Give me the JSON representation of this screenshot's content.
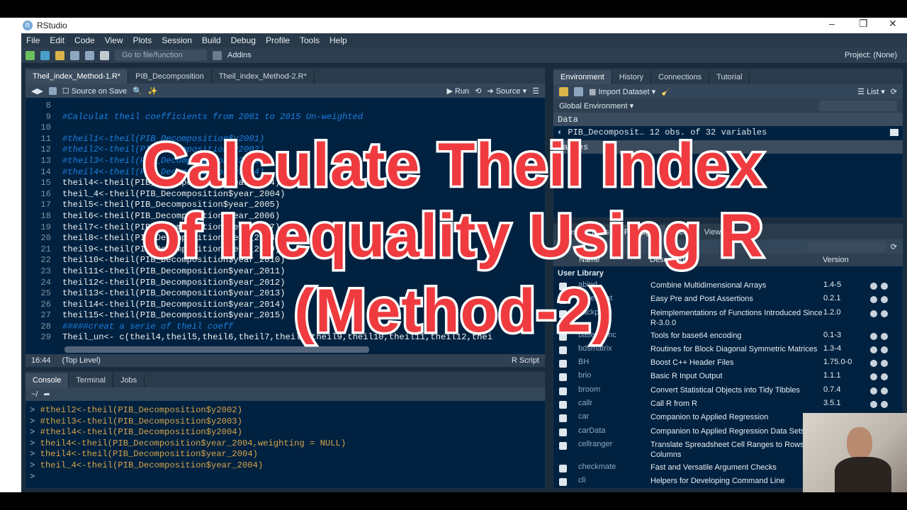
{
  "window": {
    "title": "RStudio",
    "controls": [
      "–",
      "❐",
      "✕"
    ]
  },
  "menu": [
    "File",
    "Edit",
    "Code",
    "View",
    "Plots",
    "Session",
    "Build",
    "Debug",
    "Profile",
    "Tools",
    "Help"
  ],
  "toolbar": {
    "goto_placeholder": "Go to file/function",
    "addins": "Addins",
    "project": "Project: (None)"
  },
  "editor": {
    "tabs": [
      {
        "label": "Theil_index_Method-1.R*",
        "active": true
      },
      {
        "label": "PIB_Decomposition",
        "active": false
      },
      {
        "label": "Theil_index_Method-2.R*",
        "active": false
      }
    ],
    "source_on_save": "Source on Save",
    "run": "Run",
    "source": "Source",
    "lines": [
      {
        "n": "8",
        "t": "",
        "c": false
      },
      {
        "n": "9",
        "t": "#Calculat theil coefficients from 2001 to 2015 Un-weighted",
        "c": true
      },
      {
        "n": "10",
        "t": "",
        "c": false
      },
      {
        "n": "11",
        "t": "#theil1<-theil(PIB_Decomposition$y2001)",
        "c": true
      },
      {
        "n": "12",
        "t": "#theil2<-theil(PIB_Decomposition$y2002)",
        "c": true
      },
      {
        "n": "13",
        "t": "#theil3<-theil(PIB_Decomposition$y2003)",
        "c": true
      },
      {
        "n": "14",
        "t": "#theil4<-theil(PIB_Decomposition$y2004)",
        "c": true
      },
      {
        "n": "15",
        "t": "theil4<-theil(PIB_Decomposition$year_2004)",
        "c": false
      },
      {
        "n": "16",
        "t": "theil_4<-theil(PIB_Decomposition$year_2004)",
        "c": false
      },
      {
        "n": "17",
        "t": "theil5<-theil(PIB_Decomposition$year_2005)",
        "c": false
      },
      {
        "n": "18",
        "t": "theil6<-theil(PIB_Decomposition$year_2006)",
        "c": false
      },
      {
        "n": "19",
        "t": "theil7<-theil(PIB_Decomposition$year_2007)",
        "c": false
      },
      {
        "n": "20",
        "t": "theil8<-theil(PIB_Decomposition$year_2008)",
        "c": false
      },
      {
        "n": "21",
        "t": "theil9<-theil(PIB_Decomposition$year_2009)",
        "c": false
      },
      {
        "n": "22",
        "t": "theil10<-theil(PIB_Decomposition$year_2010)",
        "c": false
      },
      {
        "n": "23",
        "t": "theil11<-theil(PIB_Decomposition$year_2011)",
        "c": false
      },
      {
        "n": "24",
        "t": "theil12<-theil(PIB_Decomposition$year_2012)",
        "c": false
      },
      {
        "n": "25",
        "t": "theil13<-theil(PIB_Decomposition$year_2013)",
        "c": false
      },
      {
        "n": "26",
        "t": "theil14<-theil(PIB_Decomposition$year_2014)",
        "c": false
      },
      {
        "n": "27",
        "t": "theil15<-theil(PIB_Decomposition$year_2015)",
        "c": false
      },
      {
        "n": "28",
        "t": "#####creat a serie of theil coeff",
        "c": true
      },
      {
        "n": "29",
        "t": "Theil_un<- c(theil4,theil5,theil6,theil7,theil8,theil9,theil10,theil11,theil12,thei",
        "c": false
      },
      {
        "n": "30",
        "t": "###########creat time series",
        "c": true
      }
    ],
    "status": {
      "pos": "16:44",
      "scope": "(Top Level)",
      "type": "R Script"
    }
  },
  "console": {
    "tabs": [
      "Console",
      "Terminal",
      "Jobs"
    ],
    "path": "~/",
    "lines": [
      "#theil2<-theil(PIB_Decomposition$y2002)",
      "#theil3<-theil(PIB_Decomposition$y2003)",
      "#theil4<-theil(PIB_Decomposition$y2004)",
      "theil4<-theil(PIB_Decomposition$year_2004,weighting = NULL)",
      "theil4<-theil(PIB_Decomposition$year_2004)",
      "theil_4<-theil(PIB_Decomposition$year_2004)"
    ],
    "prompt": ">"
  },
  "environment": {
    "tabs": [
      "Environment",
      "History",
      "Connections",
      "Tutorial"
    ],
    "import": "Import Dataset",
    "list": "List",
    "scope": "Global Environment",
    "data_header": "Data",
    "data_row": "PIB_Decomposit… 12 obs. of 32 variables",
    "values_header": "Values"
  },
  "packages": {
    "tabs": [
      "Files",
      "Plots",
      "Packages",
      "Help",
      "Viewer"
    ],
    "columns": [
      "Name",
      "Description",
      "Version"
    ],
    "section": "User Library",
    "rows": [
      {
        "name": "abind",
        "desc": "Combine Multidimensional Arrays",
        "ver": "1.4-5"
      },
      {
        "name": "assertthat",
        "desc": "Easy Pre and Post Assertions",
        "ver": "0.2.1"
      },
      {
        "name": "backports",
        "desc": "Reimplementations of Functions Introduced Since R-3.0.0",
        "ver": "1.2.0",
        "tall": true
      },
      {
        "name": "base64enc",
        "desc": "Tools for base64 encoding",
        "ver": "0.1-3"
      },
      {
        "name": "bdsmatrix",
        "desc": "Routines for Block Diagonal Symmetric Matrices",
        "ver": "1.3-4"
      },
      {
        "name": "BH",
        "desc": "Boost C++ Header Files",
        "ver": "1.75.0-0"
      },
      {
        "name": "brio",
        "desc": "Basic R Input Output",
        "ver": "1.1.1"
      },
      {
        "name": "broom",
        "desc": "Convert Statistical Objects into Tidy Tibbles",
        "ver": "0.7.4"
      },
      {
        "name": "callr",
        "desc": "Call R from R",
        "ver": "3.5.1"
      },
      {
        "name": "car",
        "desc": "Companion to Applied Regression",
        "ver": ""
      },
      {
        "name": "carData",
        "desc": "Companion to Applied Regression Data Sets",
        "ver": ""
      },
      {
        "name": "cellranger",
        "desc": "Translate Spreadsheet Cell Ranges to Rows and Columns",
        "ver": "",
        "tall": true
      },
      {
        "name": "checkmate",
        "desc": "Fast and Versatile Argument Checks",
        "ver": ""
      },
      {
        "name": "cli",
        "desc": "Helpers for Developing Command Line",
        "ver": ""
      }
    ]
  },
  "overlay": {
    "line1": "Calculate Theil Index",
    "line2": "of Inequality Using R",
    "line3": "(Method-2)",
    "color": "#ef3b3f"
  }
}
